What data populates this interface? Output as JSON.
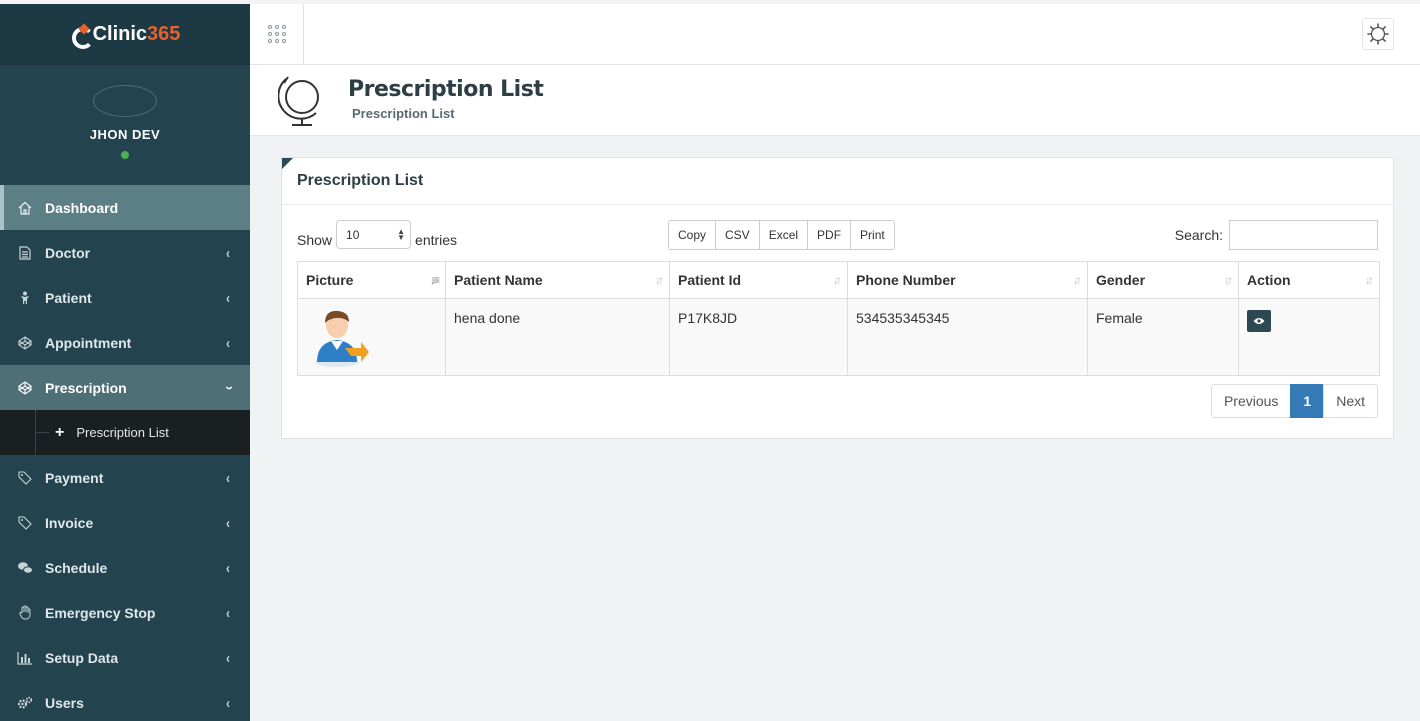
{
  "brand": {
    "part1": "Clinic",
    "part2": "365"
  },
  "profile": {
    "name": "JHON DEV"
  },
  "sidebar": {
    "items": [
      {
        "label": "Dashboard",
        "icon": "home-icon"
      },
      {
        "label": "Doctor",
        "icon": "document-icon"
      },
      {
        "label": "Patient",
        "icon": "person-icon"
      },
      {
        "label": "Appointment",
        "icon": "codepen-icon"
      },
      {
        "label": "Prescription",
        "icon": "codepen-icon"
      },
      {
        "label": "Payment",
        "icon": "tag-icon"
      },
      {
        "label": "Invoice",
        "icon": "tag-icon"
      },
      {
        "label": "Schedule",
        "icon": "chat-icon"
      },
      {
        "label": "Emergency Stop",
        "icon": "hand-icon"
      },
      {
        "label": "Setup Data",
        "icon": "bar-chart-icon"
      },
      {
        "label": "Users",
        "icon": "gears-icon"
      }
    ],
    "sub_item": "Prescription List"
  },
  "page": {
    "title": "Prescription List",
    "breadcrumb": "Prescription List"
  },
  "card": {
    "title": "Prescription List"
  },
  "controls": {
    "show": "Show",
    "entries_value": "10",
    "entries": "entries",
    "buttons": [
      "Copy",
      "CSV",
      "Excel",
      "PDF",
      "Print"
    ],
    "search_label": "Search:"
  },
  "table": {
    "headers": [
      "Picture",
      "Patient Name",
      "Patient Id",
      "Phone Number",
      "Gender",
      "Action"
    ],
    "rows": [
      {
        "name": "hena done",
        "id": "P17K8JD",
        "phone": "534535345345",
        "gender": "Female"
      }
    ]
  },
  "pager": {
    "previous": "Previous",
    "page": "1",
    "next": "Next"
  },
  "colors": {
    "sidebar": "#23444f",
    "accent": "#e8602c",
    "active_page": "#337ab7"
  }
}
